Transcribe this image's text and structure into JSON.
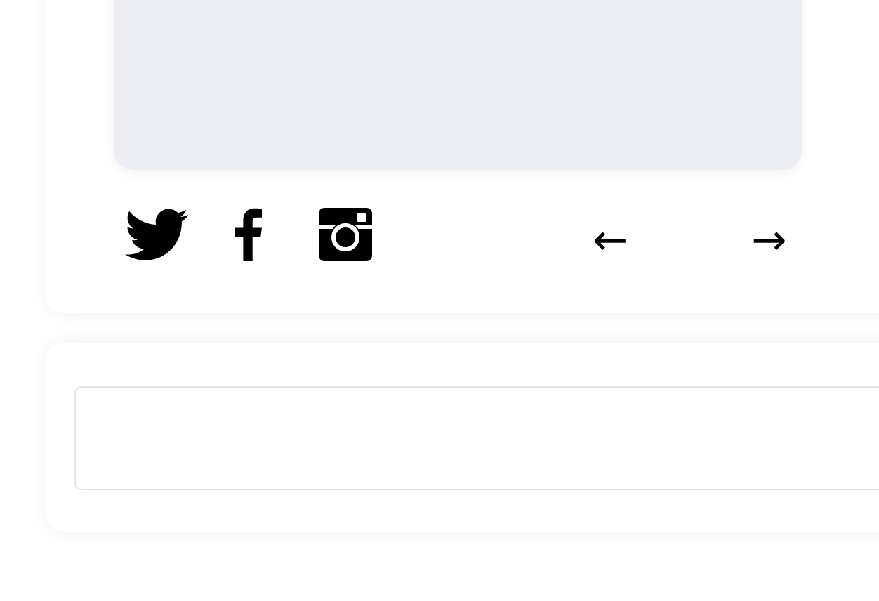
{
  "media_panel": {
    "kind": "empty"
  },
  "social_icons": [
    {
      "kind": "bird"
    },
    {
      "kind": "letter-f"
    },
    {
      "kind": "camera"
    }
  ],
  "carousel_nav": {
    "previous": "←",
    "next": "→"
  },
  "text_field": {
    "kind": "input"
  }
}
